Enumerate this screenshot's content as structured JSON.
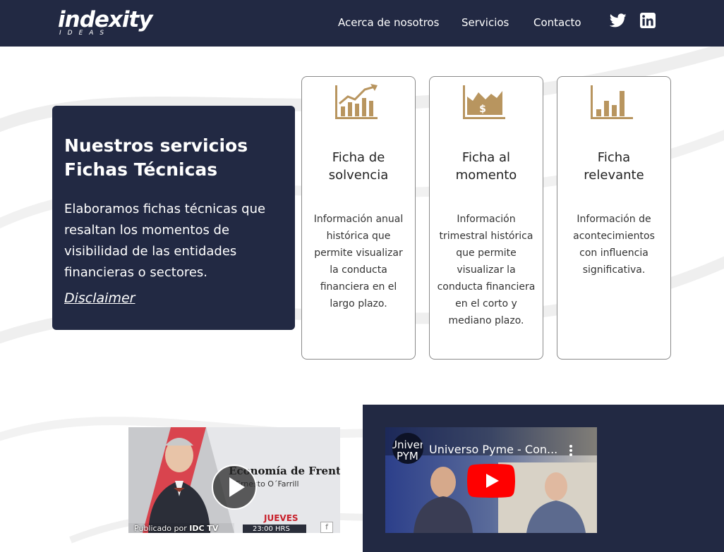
{
  "header": {
    "logo_text": "indexity",
    "logo_subtext": "IDEAS",
    "nav": {
      "about": "Acerca de nosotros",
      "services": "Servicios",
      "contact": "Contacto"
    },
    "social": [
      "twitter-icon",
      "linkedin-icon"
    ]
  },
  "hero": {
    "title_line1": "Nuestros servicios",
    "title_line2": "Fichas Técnicas",
    "description": "Elaboramos fichas técnicas que resaltan los momentos de visibilidad de las entidades financieras o sectores.",
    "link": "Disclaimer"
  },
  "services": [
    {
      "icon": "growth-chart-icon",
      "title": "Ficha de solvencia",
      "description": "Información anual histórica que permite visualizar la conducta financiera en el largo plazo."
    },
    {
      "icon": "money-chart-icon",
      "title": "Ficha al momento",
      "description": "Información trimestral histórica que permite visualizar la conducta financiera en el corto y mediano plazo."
    },
    {
      "icon": "bar-chart-icon",
      "title": "Ficha relevante",
      "description": "Información de acontecimientos con influencia significativa."
    }
  ],
  "videos": [
    {
      "show_title": "Economía de Frente",
      "host": "Ernesto O´Farrill",
      "day": "JUEVES",
      "time": "23:00 HRS",
      "published_by": "Publicado por",
      "channel": "IDC TV"
    },
    {
      "title": "Universo Pyme - Con...",
      "logo_text_1": "Univer",
      "logo_text_2": "PYM"
    }
  ],
  "colors": {
    "navy": "#222943",
    "gold": "#b8955f",
    "youtube_red": "#ff0000"
  }
}
